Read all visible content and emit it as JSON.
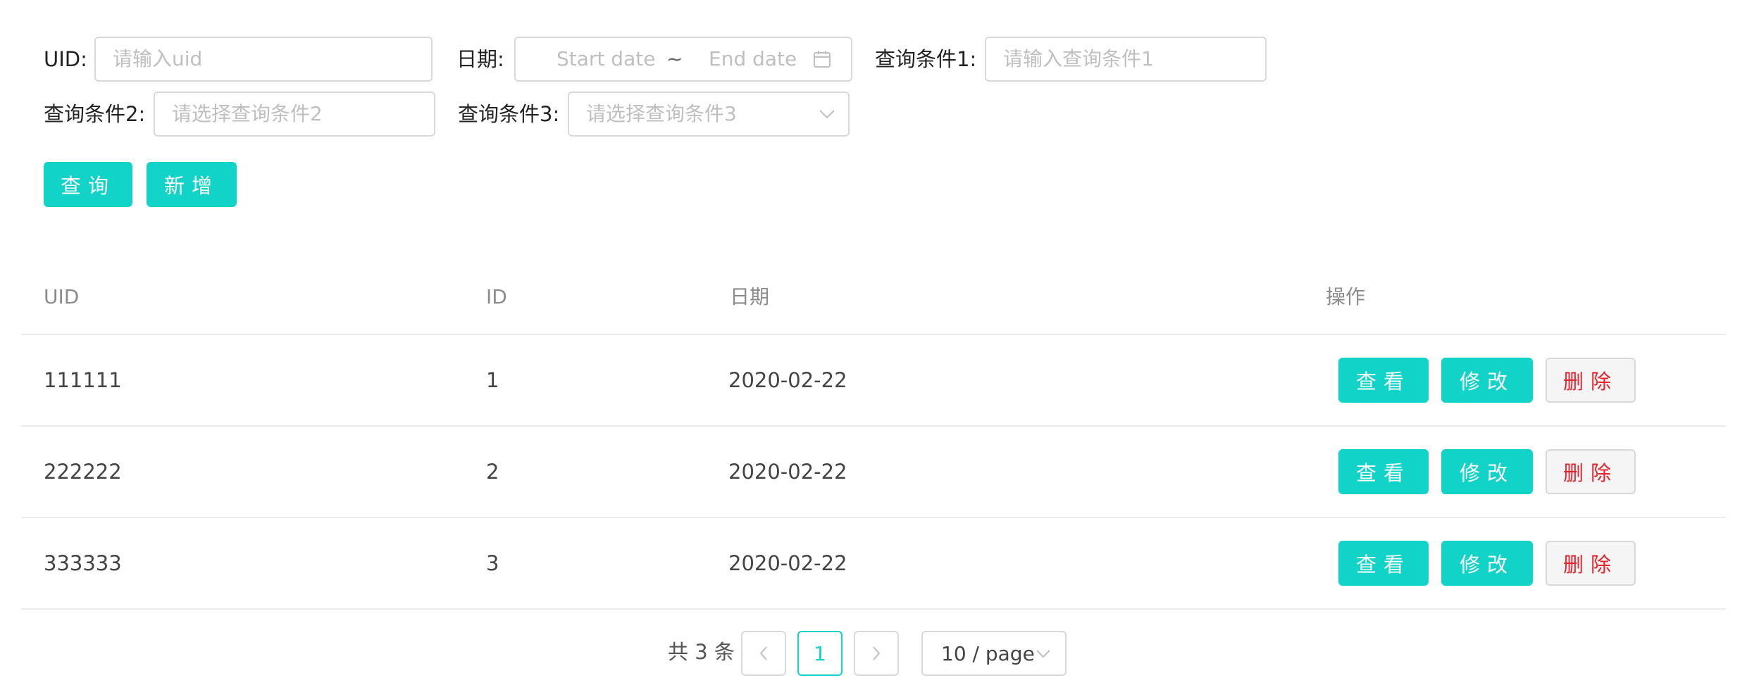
{
  "filters": {
    "uid": {
      "label": "UID:",
      "placeholder": "请输入uid"
    },
    "date": {
      "label": "日期:",
      "start_placeholder": "Start date",
      "separator": "~",
      "end_placeholder": "End date"
    },
    "cond1": {
      "label": "查询条件1:",
      "placeholder": "请输入查询条件1"
    },
    "cond2": {
      "label": "查询条件2:",
      "placeholder": "请选择查询条件2"
    },
    "cond3": {
      "label": "查询条件3:",
      "placeholder": "请选择查询条件3"
    }
  },
  "actions": {
    "query_label": "查询",
    "add_label": "新增"
  },
  "table": {
    "headers": {
      "uid": "UID",
      "id": "ID",
      "date": "日期",
      "ops": "操作"
    },
    "rows": [
      {
        "uid": "111111",
        "id": "1",
        "date": "2020-02-22",
        "view": "查看",
        "edit": "修改",
        "delete": "删除"
      },
      {
        "uid": "222222",
        "id": "2",
        "date": "2020-02-22",
        "view": "查看",
        "edit": "修改",
        "delete": "删除"
      },
      {
        "uid": "333333",
        "id": "3",
        "date": "2020-02-22",
        "view": "查看",
        "edit": "修改",
        "delete": "删除"
      }
    ]
  },
  "pagination": {
    "total_text": "共 3 条",
    "prev_icon": "‹",
    "current_page": "1",
    "next_icon": "›",
    "page_size": "10 / page"
  },
  "colors": {
    "primary": "#12d3c8",
    "danger": "#e8202a",
    "border": "#d9d9d9"
  }
}
